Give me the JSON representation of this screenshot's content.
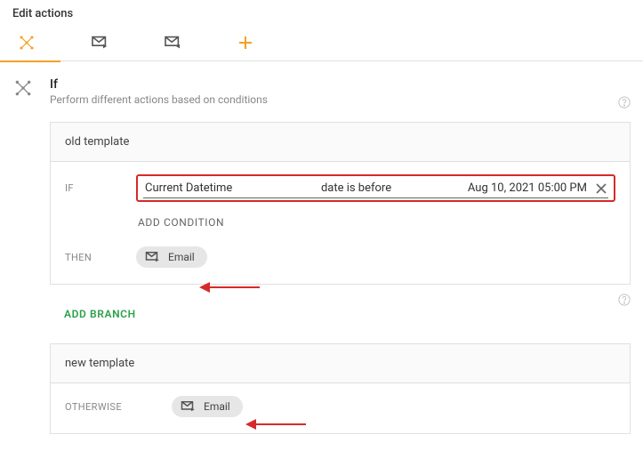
{
  "header": {
    "title": "Edit actions"
  },
  "section": {
    "title": "If",
    "subtitle": "Perform different actions based on conditions"
  },
  "branch1": {
    "title": "old template",
    "if_label": "IF",
    "condition": {
      "field": "Current Datetime",
      "operator": "date is before",
      "value": "Aug 10, 2021 05:00 PM"
    },
    "add_condition": "ADD CONDITION",
    "then_label": "THEN",
    "chip_label": "Email"
  },
  "add_branch": "ADD BRANCH",
  "branch2": {
    "title": "new template",
    "otherwise_label": "OTHERWISE",
    "chip_label": "Email"
  }
}
